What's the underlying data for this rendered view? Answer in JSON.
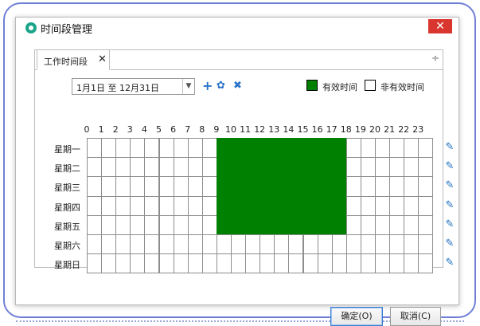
{
  "window": {
    "title": "时间段管理",
    "close_glyph": "✕"
  },
  "tab": {
    "label": "工作时间段",
    "close_glyph": "✕",
    "add_glyph": "÷"
  },
  "date_range": {
    "value": "1月1日 至 12月31日"
  },
  "toolbar": {
    "add_glyph": "+",
    "settings_glyph": "✿",
    "delete_glyph": "✖"
  },
  "legend": {
    "valid_label": "有效时间",
    "invalid_label": "非有效时间",
    "valid_color": "#008000",
    "invalid_color": "#ffffff"
  },
  "hours": [
    "0",
    "1",
    "2",
    "3",
    "4",
    "5",
    "6",
    "7",
    "8",
    "9",
    "10",
    "11",
    "12",
    "13",
    "14",
    "15",
    "16",
    "17",
    "18",
    "19",
    "20",
    "21",
    "22",
    "23"
  ],
  "days": [
    {
      "label": "星期一",
      "active": [
        9,
        10,
        11,
        12,
        13,
        14,
        15,
        16,
        17
      ]
    },
    {
      "label": "星期二",
      "active": [
        9,
        10,
        11,
        12,
        13,
        14,
        15,
        16,
        17
      ]
    },
    {
      "label": "星期三",
      "active": [
        9,
        10,
        11,
        12,
        13,
        14,
        15,
        16,
        17
      ]
    },
    {
      "label": "星期四",
      "active": [
        9,
        10,
        11,
        12,
        13,
        14,
        15,
        16,
        17
      ]
    },
    {
      "label": "星期五",
      "active": [
        9,
        10,
        11,
        12,
        13,
        14,
        15,
        16,
        17
      ]
    },
    {
      "label": "星期六",
      "active": []
    },
    {
      "label": "星期日",
      "active": []
    }
  ],
  "edit_icon": "pencil-icon",
  "buttons": {
    "ok": "确定(O)",
    "cancel": "取消(C)"
  }
}
